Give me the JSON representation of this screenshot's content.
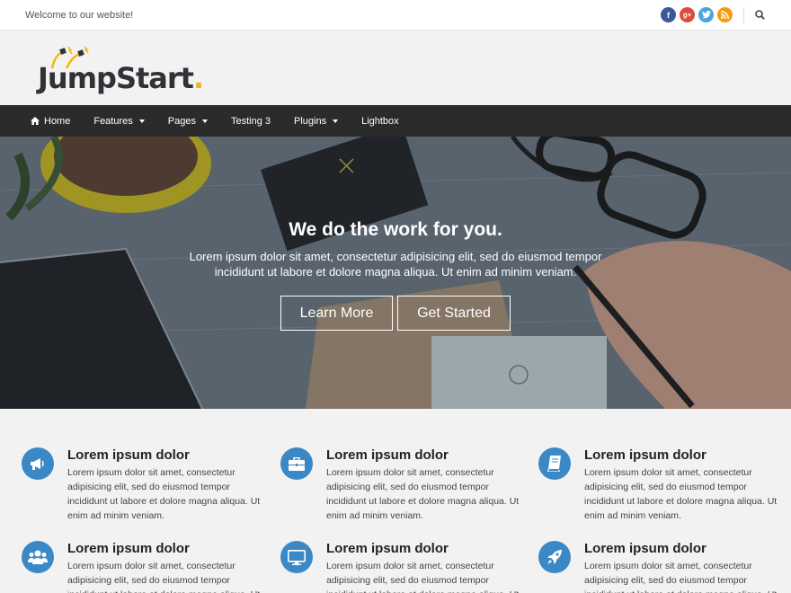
{
  "topbar": {
    "tagline": "Welcome to our website!",
    "social": [
      {
        "icon": "facebook-icon",
        "glyph": "f"
      },
      {
        "icon": "google-plus-icon",
        "glyph": "g+"
      },
      {
        "icon": "twitter-icon",
        "glyph": "t"
      },
      {
        "icon": "rss-icon",
        "glyph": "r"
      }
    ]
  },
  "logo": {
    "text_main": "JumpStart",
    "text_dot": "."
  },
  "nav": {
    "items": [
      {
        "label": "Home",
        "icon": "home-icon"
      },
      {
        "label": "Features",
        "dropdown": true
      },
      {
        "label": "Pages",
        "dropdown": true
      },
      {
        "label": "Testing 3"
      },
      {
        "label": "Plugins",
        "dropdown": true
      },
      {
        "label": "Lightbox"
      }
    ]
  },
  "hero": {
    "title": "We do the work for you.",
    "text": "Lorem ipsum dolor sit amet, consectetur adipisicing elit, sed do eiusmod tempor incididunt ut labore et dolore magna aliqua. Ut enim ad minim veniam.",
    "learn_more": "Learn More",
    "get_started": "Get Started"
  },
  "features": [
    {
      "icon": "megaphone-icon",
      "title": "Lorem ipsum dolor",
      "text": "Lorem ipsum dolor sit amet, consectetur adipisicing elit, sed do eiusmod tempor incididunt ut labore et dolore magna aliqua. Ut enim ad minim veniam."
    },
    {
      "icon": "briefcase-icon",
      "title": "Lorem ipsum dolor",
      "text": "Lorem ipsum dolor sit amet, consectetur adipisicing elit, sed do eiusmod tempor incididunt ut labore et dolore magna aliqua. Ut enim ad minim veniam."
    },
    {
      "icon": "book-icon",
      "title": "Lorem ipsum dolor",
      "text": "Lorem ipsum dolor sit amet, consectetur adipisicing elit, sed do eiusmod tempor incididunt ut labore et dolore magna aliqua. Ut enim ad minim veniam."
    },
    {
      "icon": "users-icon",
      "title": "Lorem ipsum dolor",
      "text": "Lorem ipsum dolor sit amet, consectetur adipisicing elit, sed do eiusmod tempor incididunt ut labore et dolore magna aliqua. Ut enim ad minim veniam."
    },
    {
      "icon": "desktop-icon",
      "title": "Lorem ipsum dolor",
      "text": "Lorem ipsum dolor sit amet, consectetur adipisicing elit, sed do eiusmod tempor incididunt ut labore et dolore magna aliqua. Ut enim ad minim veniam."
    },
    {
      "icon": "rocket-icon",
      "title": "Lorem ipsum dolor",
      "text": "Lorem ipsum dolor sit amet, consectetur adipisicing elit, sed do eiusmod tempor incididunt ut labore et dolore magna aliqua. Ut enim ad minim veniam."
    }
  ],
  "colors": {
    "accent": "#3b88c6",
    "nav_bg": "#2b2b2b",
    "logo_yellow": "#f4b70f"
  }
}
